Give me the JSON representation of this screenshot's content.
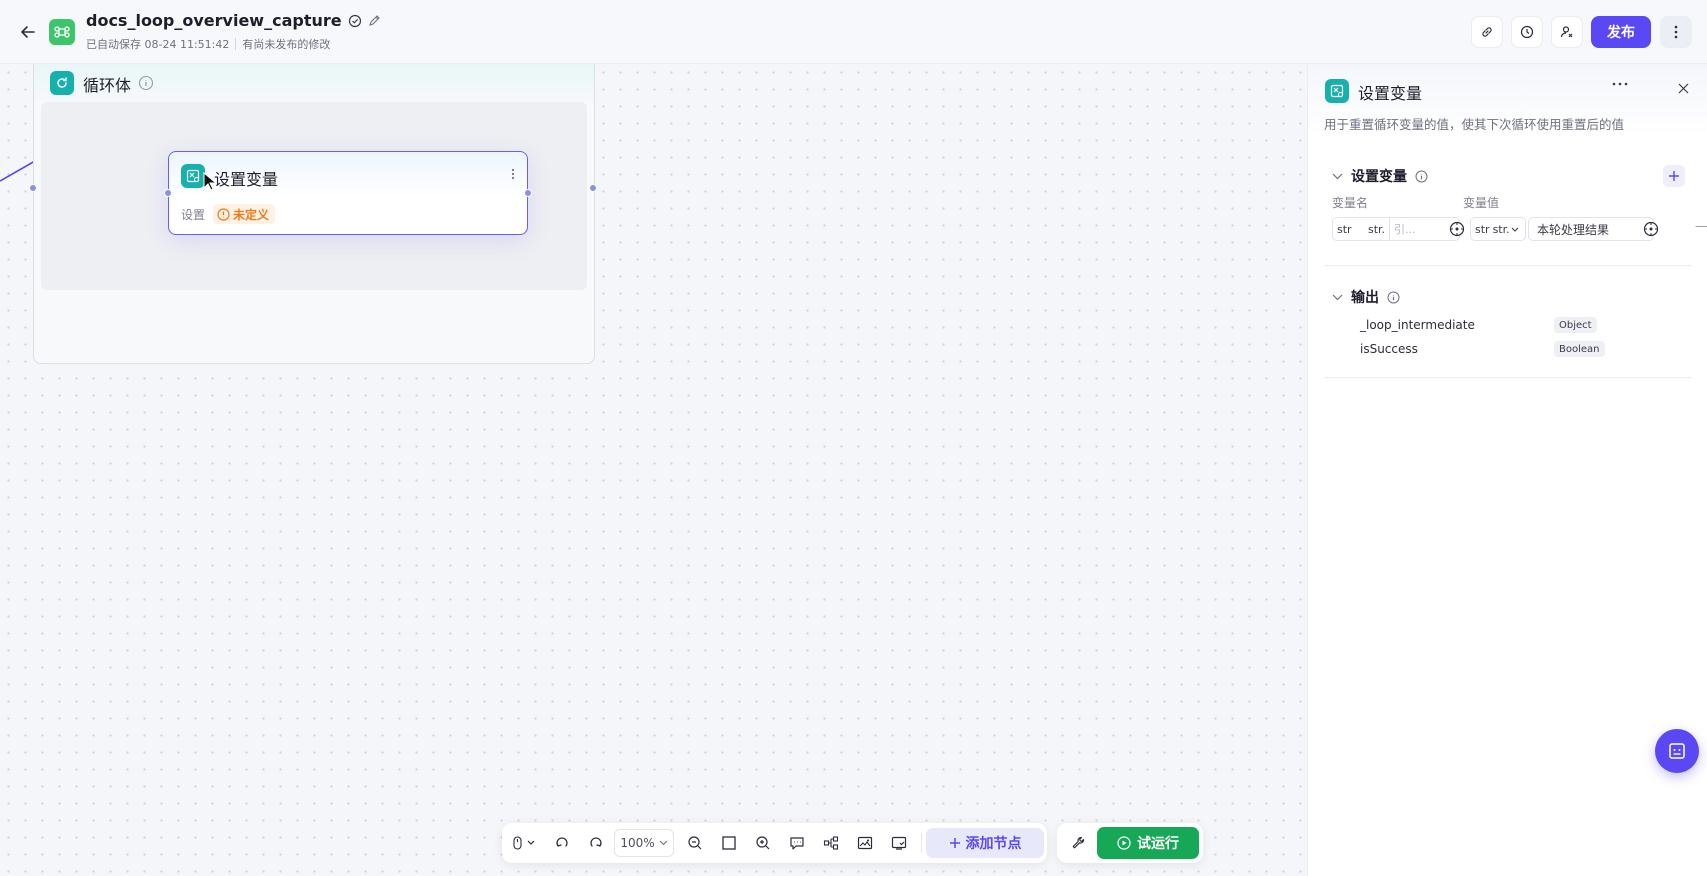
{
  "header": {
    "title": "docs_loop_overview_capture",
    "autosave": "已自动保存 08-24 11:51:42",
    "unpublished": "有尚未发布的修改",
    "publish_label": "发布"
  },
  "canvas": {
    "loop_title": "循环体",
    "node": {
      "title": "设置变量",
      "setting_label": "设置",
      "warning_text": "未定义"
    }
  },
  "toolbar": {
    "zoom": "100%",
    "add_node_label": "添加节点",
    "run_label": "试运行"
  },
  "panel": {
    "title": "设置变量",
    "description": "用于重置循环变量的值，使其下次循环使用重置后的值",
    "set_section_title": "设置变量",
    "col_name": "变量名",
    "col_value": "变量值",
    "row": {
      "name_type": "str",
      "name_select": "str.",
      "name_ref": "引...",
      "value_type": "str",
      "value_select": "str.",
      "value_text": "本轮处理结果"
    },
    "output_title": "输出",
    "outputs": [
      {
        "name": "_loop_intermediate",
        "type": "Object"
      },
      {
        "name": "isSuccess",
        "type": "Boolean"
      }
    ]
  },
  "colors": {
    "accent": "#5a48f4",
    "run_green": "#17a857",
    "node_teal": "#17b1ad",
    "warning_orange": "#ef7a1a"
  }
}
